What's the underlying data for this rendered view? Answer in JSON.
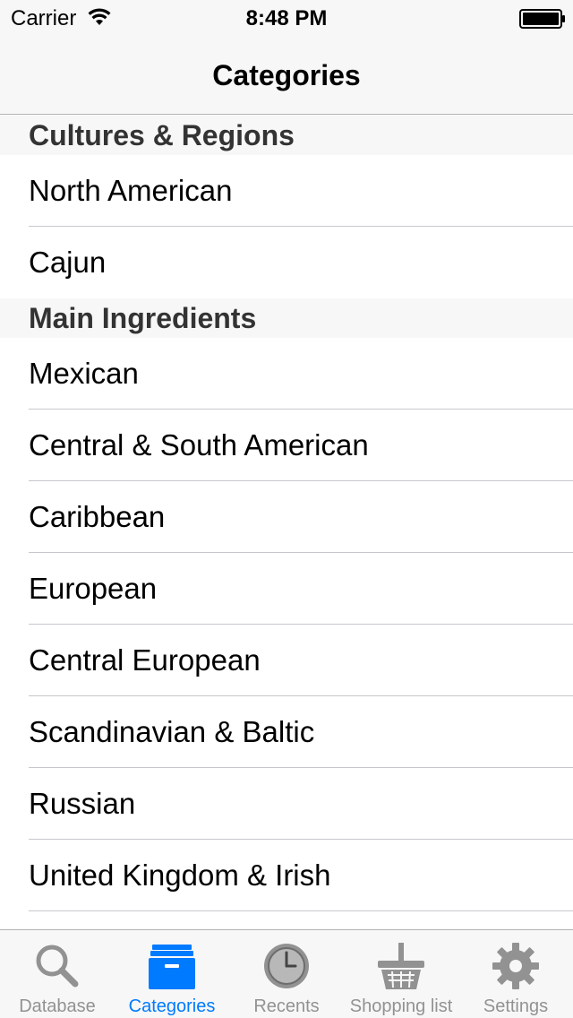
{
  "status_bar": {
    "carrier": "Carrier",
    "time": "8:48 PM",
    "wifi_icon": "wifi-icon",
    "battery_icon": "battery-icon"
  },
  "nav": {
    "title": "Categories"
  },
  "sections": [
    {
      "header": "Cultures & Regions",
      "rows": [
        "North American",
        "Cajun"
      ]
    },
    {
      "header": "Main Ingredients",
      "rows": [
        "Mexican",
        "Central & South American",
        "Caribbean",
        "European",
        "Central European",
        "Scandinavian & Baltic",
        "Russian",
        "United Kingdom & Irish"
      ]
    }
  ],
  "tab_bar": {
    "active": "categories",
    "active_color": "#007aff",
    "inactive_color": "#929292",
    "tabs": [
      {
        "label": "Database",
        "icon": "magnifier-icon"
      },
      {
        "label": "Categories",
        "icon": "file-box-icon"
      },
      {
        "label": "Recents",
        "icon": "clock-icon"
      },
      {
        "label": "Shopping list",
        "icon": "basket-icon"
      },
      {
        "label": "Settings",
        "icon": "gear-icon"
      }
    ]
  }
}
